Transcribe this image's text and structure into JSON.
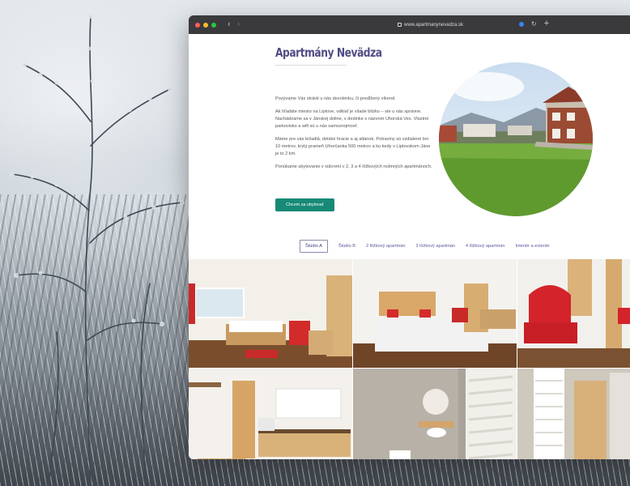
{
  "browser": {
    "url": "www.apartmanynevadza.sk"
  },
  "site": {
    "title": "Apartmány Nevädza",
    "paragraphs": [
      "Pozývame Vás strávit u nás dovolenku, či predĺžený víkend.",
      "Ak hľadáte miesto na Liptove, odkiaľ je všade blízko – ste u nás správne. Nachádzame sa v Jánskej doline, v dedinke s názvom Uhorská Ves. Vlastné parkovisko a wifi sú u nás samozrejmosť.",
      "Máme pre vás ležadlá, detské hracie a aj altánok. Potraviny sú vzdialené len 10 metrov, krytý prameň Uhorčanka 500 metrov a ku kedy v Liptovskom Jáne je to 2 km.",
      "Ponúkame ubytovanie v súkromí v 2, 3 a 4 lôžkových rodinných apartmánoch."
    ],
    "cta_label": "Chcem sa ubytovať",
    "tabs": [
      {
        "label": "Štúdio A",
        "active": true
      },
      {
        "label": "Štúdio B",
        "active": false
      },
      {
        "label": "2 lôžkový apartmán",
        "active": false
      },
      {
        "label": "3 lôžkový apartmán",
        "active": false
      },
      {
        "label": "4 lôžkový apartmán",
        "active": false
      },
      {
        "label": "Interiér a exteriér",
        "active": false
      }
    ]
  },
  "colors": {
    "title": "#4f4d86",
    "cta": "#178a77",
    "tab_text": "#5a5aa0",
    "toolbar": "#3a3a3c"
  },
  "icons": [
    "close-dot-icon",
    "minimize-dot-icon",
    "maximize-dot-icon",
    "back-arrow-icon",
    "forward-arrow-icon",
    "lock-icon",
    "extension-icon",
    "reload-icon",
    "new-tab-plus-icon"
  ]
}
